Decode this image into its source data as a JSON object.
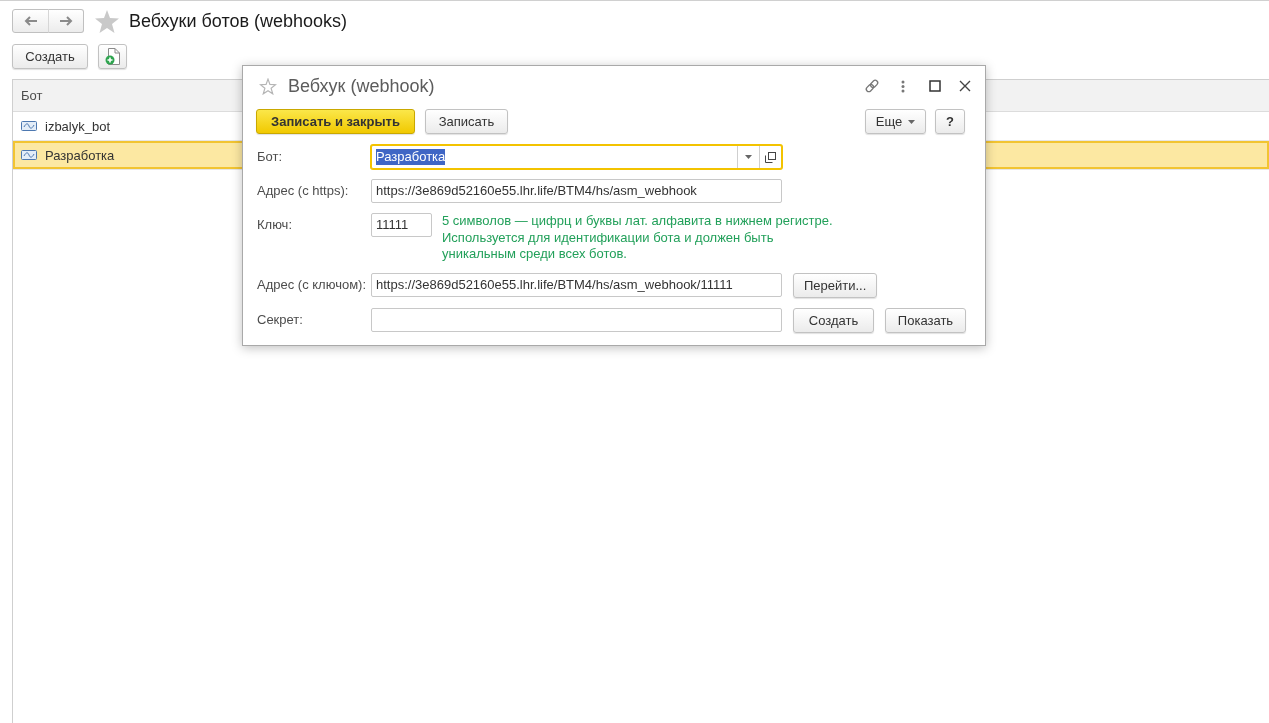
{
  "page": {
    "title": "Вебхуки ботов (webhooks)"
  },
  "toolbar": {
    "create_button": "Создать"
  },
  "table": {
    "columns": [
      "Бот"
    ],
    "rows": [
      {
        "name": "izbalyk_bot",
        "selected": false
      },
      {
        "name": "Разработка",
        "selected": true
      }
    ]
  },
  "dialog": {
    "title": "Вебхук (webhook)",
    "actions": [
      {
        "label": "Записать и закрыть",
        "kind": "primary"
      },
      {
        "label": "Записать",
        "kind": "default"
      }
    ],
    "more_button": "Еще",
    "help_button": "?",
    "fields": [
      {
        "label": "Бот:",
        "kind": "select",
        "value": "Разработка",
        "focused": true
      },
      {
        "label": "Адрес (с https):",
        "kind": "text",
        "value": "https://3e869d52160e55.lhr.life/BTM4/hs/asm_webhook",
        "focused": false
      },
      {
        "label": "Ключ:",
        "kind": "short",
        "value": "11111",
        "focused": false,
        "hint": "5 символов — цифрц и буквы лат. алфавита в нижнем регистре.\nИспользуется для идентификации бота и должен быть\nуникальным среди всех ботов."
      },
      {
        "label": "Адрес (с ключом):",
        "kind": "text",
        "value": "https://3e869d52160e55.lhr.life/BTM4/hs/asm_webhook/11111",
        "focused": false,
        "buttons": [
          "Перейти..."
        ]
      },
      {
        "label": "Секрет:",
        "kind": "text",
        "focused": false,
        "buttons": [
          "Создать",
          "Показать"
        ]
      }
    ]
  }
}
